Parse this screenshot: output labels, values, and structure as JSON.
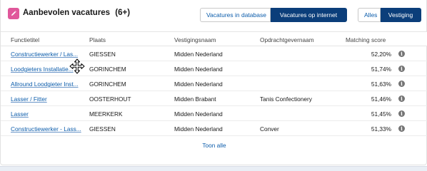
{
  "header": {
    "title": "Aanbevolen vacatures",
    "count": "(6+)",
    "icon": "edit-icon",
    "accent_color": "#e0579b"
  },
  "source_toggle": {
    "database_label": "Vacatures in database",
    "internet_label": "Vacatures op internet",
    "active": "internet"
  },
  "scope_toggle": {
    "all_label": "Alles",
    "branch_label": "Vestiging",
    "active": "branch"
  },
  "table": {
    "columns": [
      "Functietitel",
      "Plaats",
      "Vestigingsnaam",
      "Opdrachtgevernaam",
      "Matching score"
    ],
    "rows": [
      {
        "title": "Constructiewerker / Las...",
        "place": "GIESSEN",
        "branch": "Midden Nederland",
        "client": "",
        "score": "52,20%"
      },
      {
        "title": "Loodgieters Installatie...",
        "place": "GORINCHEM",
        "branch": "Midden Nederland",
        "client": "",
        "score": "51,74%"
      },
      {
        "title": "Allround Loodgieter Inst...",
        "place": "GORINCHEM",
        "branch": "Midden Nederland",
        "client": "",
        "score": "51,63%"
      },
      {
        "title": "Lasser / Fitter",
        "place": "OOSTERHOUT",
        "branch": "Midden Brabant",
        "client": "Tanis Confectionery",
        "score": "51,46%"
      },
      {
        "title": "Lasser",
        "place": "MEERKERK",
        "branch": "Midden Nederland",
        "client": "",
        "score": "51,45%"
      },
      {
        "title": "Constructiewerker - Lass...",
        "place": "GIESSEN",
        "branch": "Midden Nederland",
        "client": "Conver",
        "score": "51,33%"
      }
    ]
  },
  "footer": {
    "show_all_label": "Toon alle"
  },
  "colors": {
    "link": "#0b5cab",
    "active_button": "#0b3e7a"
  }
}
